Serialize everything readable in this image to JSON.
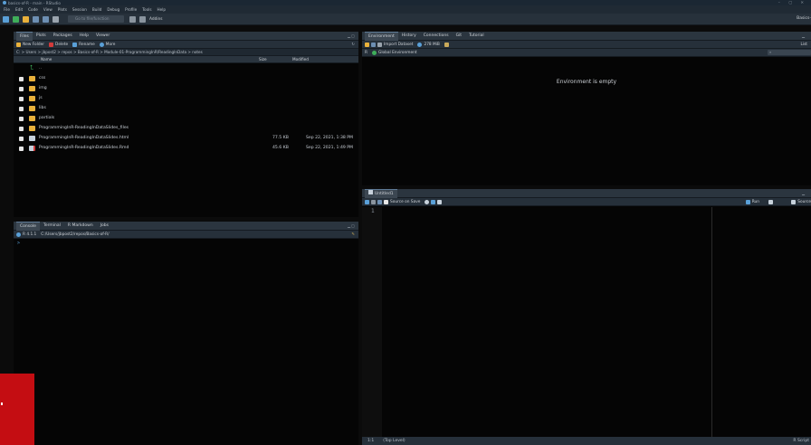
{
  "window": {
    "title": "basics-of-R - main - RStudio",
    "controls": "– ▢ ✕"
  },
  "menu": [
    "File",
    "Edit",
    "Code",
    "View",
    "Plots",
    "Session",
    "Build",
    "Debug",
    "Profile",
    "Tools",
    "Help"
  ],
  "toolbar": {
    "goto_placeholder": "Go to file/function",
    "addins": "Addins",
    "project": "Basics-"
  },
  "files_pane": {
    "tabs": [
      "Files",
      "Plots",
      "Packages",
      "Help",
      "Viewer"
    ],
    "actions": {
      "new_folder": "New Folder",
      "delete": "Delete",
      "rename": "Rename",
      "more": "More"
    },
    "breadcrumb": "C: > Users > jbpost2 > repos > Basics-of-R > Module-01-ProgrammingInR/ReadingInData > notes",
    "columns": {
      "name": "Name",
      "size": "Size",
      "modified": "Modified"
    },
    "rows": [
      {
        "name": "..",
        "type": "up",
        "size": "",
        "modified": ""
      },
      {
        "name": "css",
        "type": "folder",
        "size": "",
        "modified": ""
      },
      {
        "name": "img",
        "type": "folder",
        "size": "",
        "modified": ""
      },
      {
        "name": "js",
        "type": "folder",
        "size": "",
        "modified": ""
      },
      {
        "name": "libs",
        "type": "folder",
        "size": "",
        "modified": ""
      },
      {
        "name": "partials",
        "type": "folder",
        "size": "",
        "modified": ""
      },
      {
        "name": "ProgrammingInR-ReadingInDataSlides_files",
        "type": "folder",
        "size": "",
        "modified": ""
      },
      {
        "name": "ProgrammingInR-ReadingInDataSlides.html",
        "type": "doc",
        "size": "77.5 KB",
        "modified": "Sep 22, 2021, 1:38 PM"
      },
      {
        "name": "ProgrammingInR-ReadingInDataSlides.Rmd",
        "type": "rmd",
        "size": "45.6 KB",
        "modified": "Sep 22, 2021, 1:49 PM"
      }
    ]
  },
  "console_pane": {
    "tabs": [
      "Console",
      "Terminal",
      "R Markdown",
      "Jobs"
    ],
    "r_version": "R 4.1.1",
    "working_dir": "C:/Users/jbpost2/repos/Basics-of-R/",
    "prompt": ">"
  },
  "env_pane": {
    "tabs": [
      "Environment",
      "History",
      "Connections",
      "Git",
      "Tutorial"
    ],
    "import_dataset": "Import Dataset",
    "memory": "278 MiB",
    "list_view": "List",
    "r_label": "R",
    "global_env": "Global Environment",
    "empty_message": "Environment is empty"
  },
  "editor_pane": {
    "tab": "Untitled1",
    "source_on_save": "Source on Save",
    "run": "Run",
    "source": "Source",
    "line_number": "1",
    "status_pos": "1:1",
    "status_scope": "(Top Level)",
    "status_lang": "R Script"
  },
  "colors": {
    "folder": "#e9b13b",
    "accent": "#5a9fd6",
    "red_block": "#c40d12"
  }
}
